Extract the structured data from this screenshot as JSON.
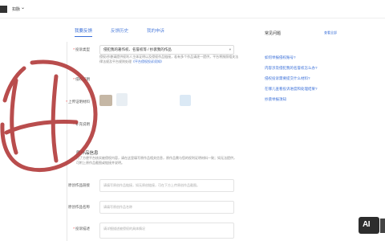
{
  "header": {
    "user_name": "扣脉",
    "user_chevron": "⌄"
  },
  "tabs": [
    {
      "label": "我要反馈",
      "active": true
    },
    {
      "label": "反馈历史",
      "active": false
    },
    {
      "label": "我的申诉",
      "active": false
    }
  ],
  "form": {
    "feedback_type_label": "投诉类型",
    "feedback_type_value": "侵犯我的著作权、名誉权等 / 抄袭我的作品",
    "hint_text": "侵权/抄袭请提供权利人主体证明以及侵权作品链接，若有多个作品请逐一提供，平台将按照相关法律法规及平台规则处理",
    "hint_link": "《平台侵权投诉须知》",
    "proof_label": "侵权证明",
    "material_label": "上传证明材料",
    "other_label": "补充说明",
    "original_section_title": "原作品信息",
    "original_section_desc": "为了方便平台核实被侵权内容，请在这里填写原作品相关信息，原作品需与您的权利证明材料一致；如无法提供，可附上原作品截图或链接并说明。",
    "orig_link_label": "原创作品链接",
    "orig_link_placeholder": "请填写原创作品链接，如无原创链接，可在下方上传原创作品截图。",
    "orig_name_label": "原创作品名称",
    "orig_name_placeholder": "请填写原创作品名称",
    "desc_label": "投诉描述",
    "desc_placeholder": "请详细描述被侵权的具体情况"
  },
  "right_panel": {
    "title": "常见问题",
    "more": "查看全部",
    "links": [
      "如何举报侵权账号?",
      "内容涉及侵犯我的名誉权怎么办?",
      "侵权投诉需要提交什么材料?",
      "在哪儿查看投诉进度和处理结果?",
      "抄袭举报须知"
    ]
  },
  "badge": {
    "label": "AI"
  },
  "colors": {
    "accent": "#3a6fd8",
    "scribble": "#b23a3a"
  }
}
